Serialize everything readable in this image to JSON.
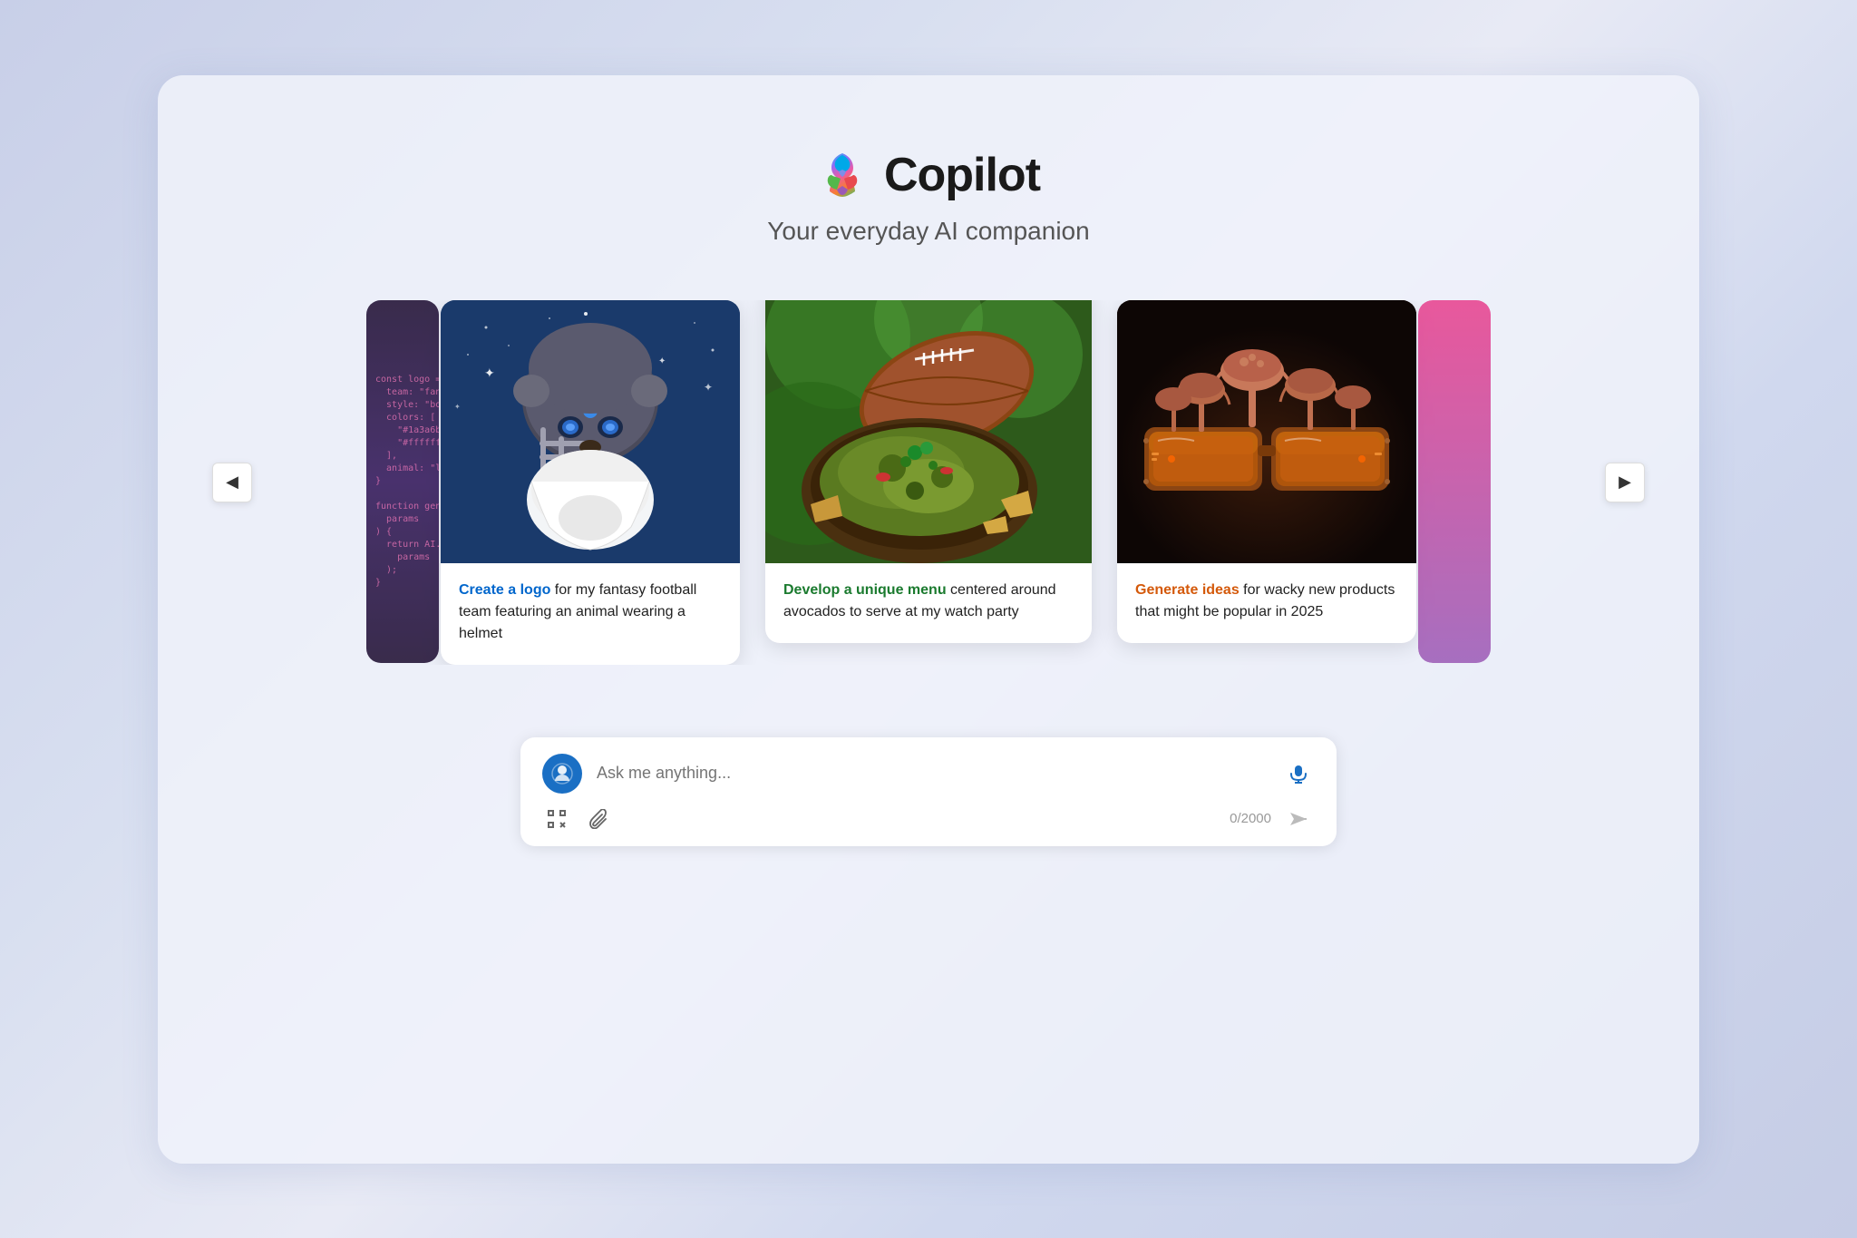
{
  "app": {
    "title": "Copilot",
    "subtitle": "Your everyday AI companion"
  },
  "carousel": {
    "prev_label": "◀",
    "next_label": "▶",
    "cards": [
      {
        "id": "card-1",
        "action_text": "Create a logo",
        "action_color": "blue",
        "description": " for my fantasy football team featuring an animal wearing a helmet",
        "image_alt": "Fantasy football logo with lion wearing helmet"
      },
      {
        "id": "card-2",
        "action_text": "Develop a unique menu",
        "action_color": "green",
        "description": " centered around avocados to serve at my watch party",
        "image_alt": "Football and guacamole bowl"
      },
      {
        "id": "card-3",
        "action_text": "Generate ideas",
        "action_color": "orange",
        "description": " for wacky new products that might be popular in 2025",
        "image_alt": "Futuristic glasses with mushrooms"
      }
    ]
  },
  "chat": {
    "placeholder": "Ask me anything...",
    "char_count": "0/2000",
    "mic_label": "microphone",
    "send_label": "send",
    "scan_label": "scan",
    "attach_label": "attach"
  }
}
